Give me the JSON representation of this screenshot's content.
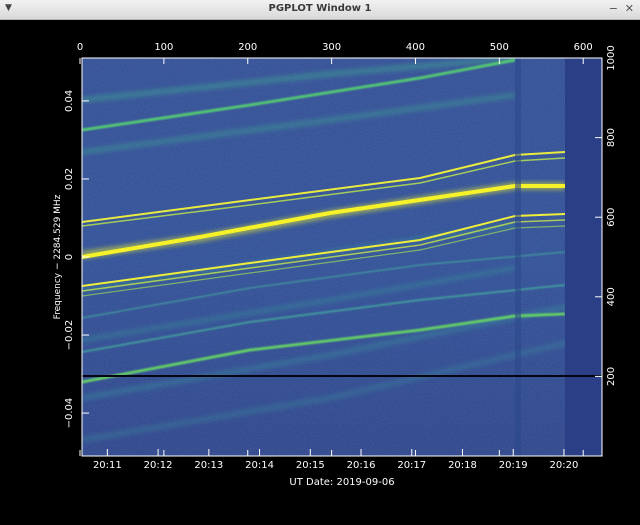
{
  "window": {
    "title": "PGPLOT Window 1",
    "menu_icon": "chevron-down-icon",
    "minimize_icon": "minimize-icon",
    "close_icon": "close-icon"
  },
  "plot": {
    "ylabel": "Frequency − 2284.529 MHz",
    "xlabel": "UT Date: 2019-09-06",
    "top_ticks": [
      "0",
      "100",
      "200",
      "300",
      "400",
      "500",
      "600"
    ],
    "bottom_ticks": [
      "20:11",
      "20:12",
      "20:13",
      "20:14",
      "20:15",
      "20:16",
      "20:17",
      "20:18",
      "20:19",
      "20:20"
    ],
    "left_ticks": [
      "0.04",
      "0.02",
      "0",
      "−0.02",
      "−0.04"
    ],
    "right_ticks": [
      "1000",
      "800",
      "600",
      "400",
      "200"
    ],
    "background_color": "#2a3e8a",
    "trace_color": "#f4ef24"
  },
  "chart_data": {
    "type": "heatmap",
    "xlabel": "UT Date: 2019-09-06",
    "ylabel": "Frequency − 2284.529 MHz",
    "x_range_time": [
      "20:10:30",
      "20:20:45"
    ],
    "x_top_range": [
      0,
      620
    ],
    "y_range": [
      -0.051,
      0.051
    ],
    "y_right_range": [
      0,
      1000
    ],
    "colormap": "viridis"
  }
}
